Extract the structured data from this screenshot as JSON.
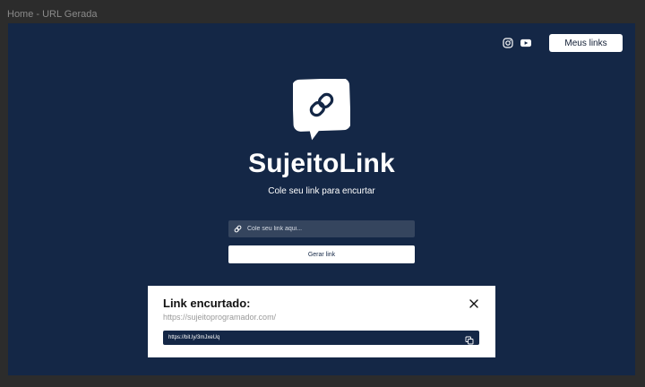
{
  "frame": {
    "title": "Home - URL Gerada"
  },
  "header": {
    "icons": [
      "instagram-icon",
      "youtube-icon"
    ],
    "meus_links_label": "Meus links"
  },
  "hero": {
    "brand": "SujeitoLink",
    "subtitle": "Cole seu link para encurtar"
  },
  "form": {
    "input_placeholder": "Cole seu link aqui...",
    "input_value": "",
    "submit_label": "Gerar link"
  },
  "modal": {
    "title": "Link encurtado:",
    "original_url": "https://sujeitoprogramador.com/",
    "short_url": "https://bit.ly/3mJxeUq"
  },
  "colors": {
    "background": "#142746",
    "frame": "#2c2c2c",
    "input_bg": "#35455e",
    "white": "#ffffff"
  }
}
